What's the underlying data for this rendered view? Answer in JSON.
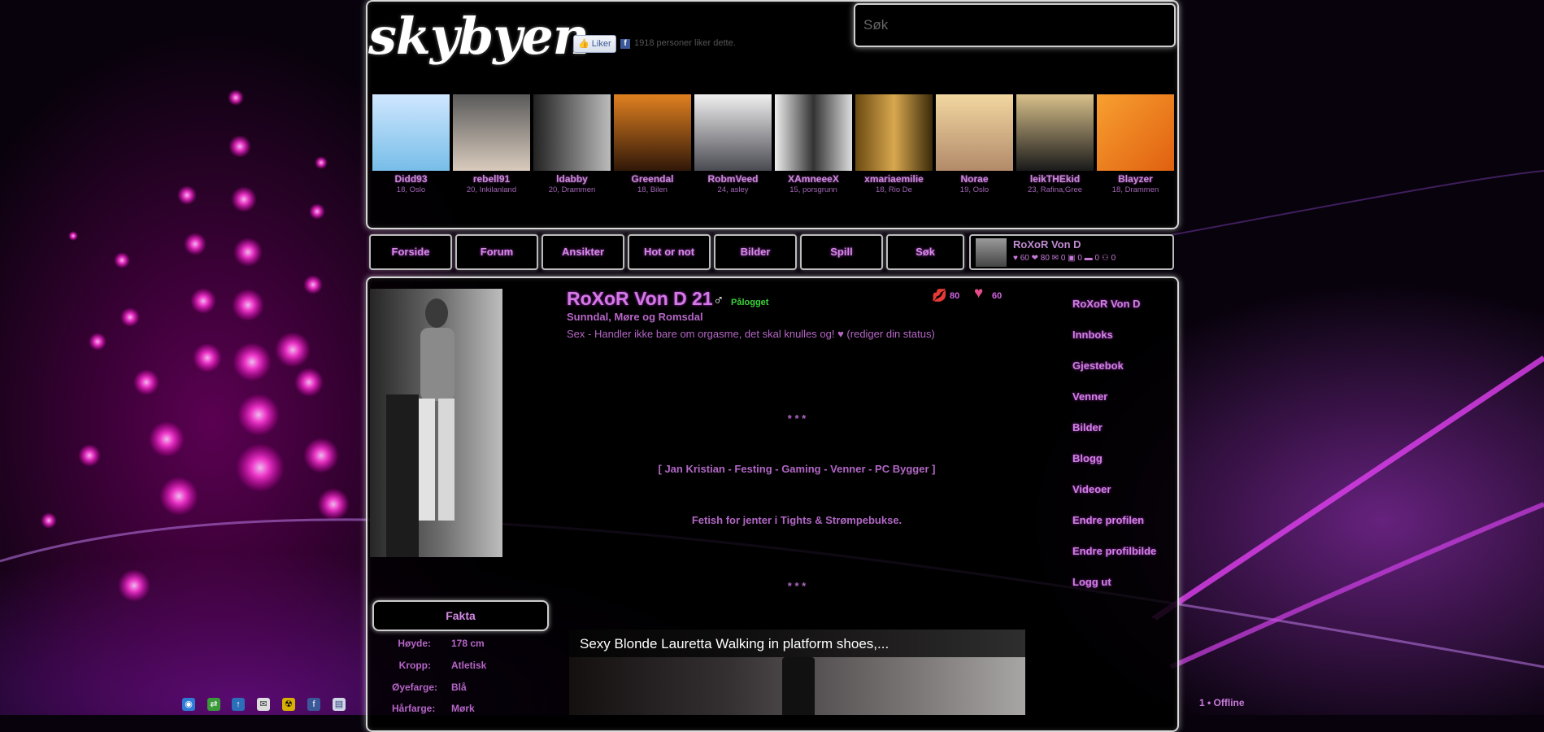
{
  "site": {
    "logo_text": "skybyen",
    "like_label": "Liker",
    "like_count_text": "1918 personer liker dette.",
    "search_placeholder": "Søk"
  },
  "featured_users": [
    {
      "name": "Didd93",
      "meta": "18, Oslo"
    },
    {
      "name": "rebell91",
      "meta": "20, Inkilanland"
    },
    {
      "name": "ldabby",
      "meta": "20, Drammen"
    },
    {
      "name": "Greendal",
      "meta": "18, Bilen"
    },
    {
      "name": "RobmVeed",
      "meta": "24, asley"
    },
    {
      "name": "XAmneeeX",
      "meta": "15, porsgrunn"
    },
    {
      "name": "xmariaemilie",
      "meta": "18, Rio De"
    },
    {
      "name": "Norae",
      "meta": "19, Oslo"
    },
    {
      "name": "leikTHEkid",
      "meta": "23, Rafina,Gree"
    },
    {
      "name": "Blayzer",
      "meta": "18, Drammen"
    }
  ],
  "nav": [
    {
      "label": "Forside"
    },
    {
      "label": "Forum"
    },
    {
      "label": "Ansikter"
    },
    {
      "label": "Hot or not"
    },
    {
      "label": "Bilder"
    },
    {
      "label": "Spill"
    },
    {
      "label": "Søk"
    }
  ],
  "current_user": {
    "name": "RoXoR Von D",
    "stats": "♥ 60  ❤ 80  ✉ 0  ▣ 0  ▬ 0  ⚇ 0"
  },
  "profile": {
    "name": "RoXoR Von D",
    "age": "21",
    "online_label": "Pålogget",
    "location": "Sunndal, Møre og Romsdal",
    "status": "Sex - Handler ikke bare om orgasme, det skal knulles og! ♥ (rediger din status)",
    "kisses": "80",
    "hearts": "60",
    "bio_lines": [
      "* * *",
      "[ Jan Kristian - Festing - Gaming - Venner - PC Bygger ]",
      "Fetish for jenter i Tights & Strømpebukse.",
      "* * *"
    ]
  },
  "side_menu": [
    {
      "label": "RoXoR Von D"
    },
    {
      "label": "Innboks"
    },
    {
      "label": "Gjestebok"
    },
    {
      "label": "Venner"
    },
    {
      "label": "Bilder"
    },
    {
      "label": "Blogg"
    },
    {
      "label": "Videoer"
    },
    {
      "label": "Endre profilen"
    },
    {
      "label": "Endre profilbilde"
    },
    {
      "label": "Logg ut"
    }
  ],
  "facts": {
    "button_label": "Fakta",
    "rows": [
      {
        "label": "Høyde:",
        "value": "178 cm"
      },
      {
        "label": "Kropp:",
        "value": "Atletisk"
      },
      {
        "label": "Øyefarge:",
        "value": "Blå"
      },
      {
        "label": "Hårfarge:",
        "value": "Mørk"
      }
    ]
  },
  "video": {
    "title": "Sexy Blonde Lauretta Walking in platform shoes,..."
  },
  "footer": {
    "offline_text": "1 • Offline"
  },
  "colors": {
    "accent": "#d478e6",
    "online": "#3ad33a",
    "panel_border": "#d8d8d8"
  }
}
